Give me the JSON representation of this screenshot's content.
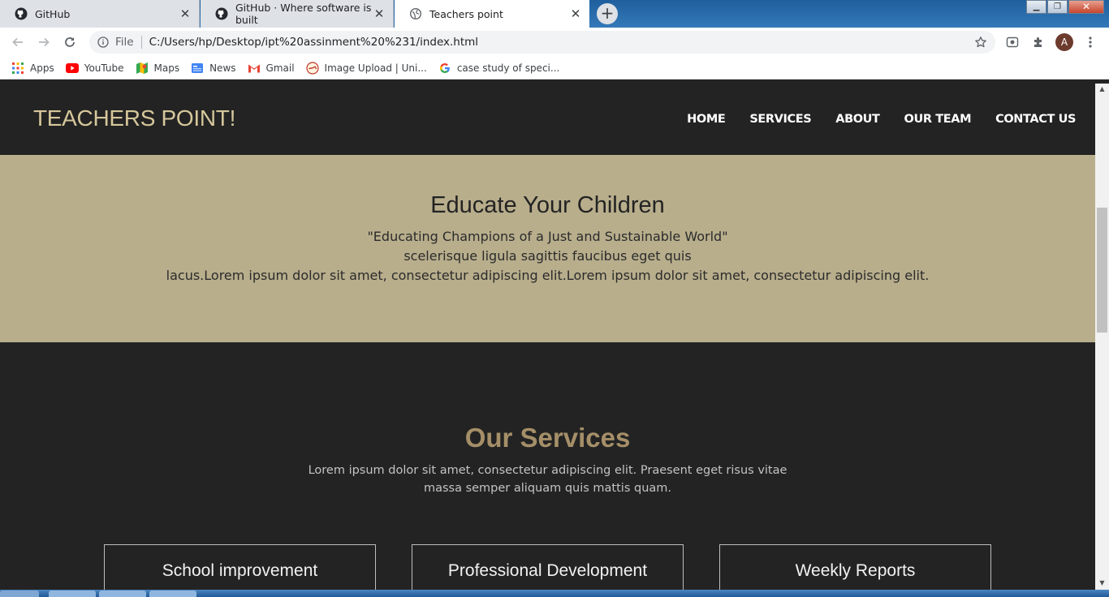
{
  "browser": {
    "tabs": [
      {
        "title": "GitHub",
        "icon": "github-icon",
        "active": false
      },
      {
        "title": "GitHub · Where software is built",
        "icon": "github-icon",
        "active": false
      },
      {
        "title": "Teachers point",
        "icon": "globe-icon",
        "active": true
      }
    ],
    "close_glyph": "✕",
    "new_tab_glyph": "+",
    "address": {
      "scheme": "File",
      "url": "C:/Users/hp/Desktop/ipt%20assinment%20%231/index.html"
    },
    "profile_initial": "A",
    "bookmarks": [
      {
        "label": "Apps",
        "icon": "apps-grid-icon"
      },
      {
        "label": "YouTube",
        "icon": "youtube-icon"
      },
      {
        "label": "Maps",
        "icon": "maps-icon"
      },
      {
        "label": "News",
        "icon": "news-icon"
      },
      {
        "label": "Gmail",
        "icon": "gmail-icon"
      },
      {
        "label": "Image Upload | Uni...",
        "icon": "image-upload-icon"
      },
      {
        "label": "case study of speci...",
        "icon": "google-icon"
      }
    ]
  },
  "site": {
    "brand": "TEACHERS POINT!",
    "nav": [
      "HOME",
      "SERVICES",
      "ABOUT",
      "OUR TEAM",
      "CONTACT US"
    ],
    "hero": {
      "title": "Educate Your Children",
      "quote": "\"Educating Champions of a Just and Sustainable World\"",
      "line2": "scelerisque ligula sagittis faucibus eget quis",
      "line3": "lacus.Lorem ipsum dolor sit amet, consectetur adipiscing elit.Lorem ipsum dolor sit amet, consectetur adipiscing elit."
    },
    "services": {
      "title": "Our Services",
      "description": "Lorem ipsum dolor sit amet, consectetur adipiscing elit. Praesent eget risus vitae massa semper aliquam quis mattis quam.",
      "cards": [
        "School improvement",
        "Professional Development",
        "Weekly Reports"
      ]
    }
  },
  "colors": {
    "header_bg": "#232323",
    "brand": "#d6c79b",
    "hero_bg": "#b8ae8c",
    "services_title": "#a58f68"
  }
}
